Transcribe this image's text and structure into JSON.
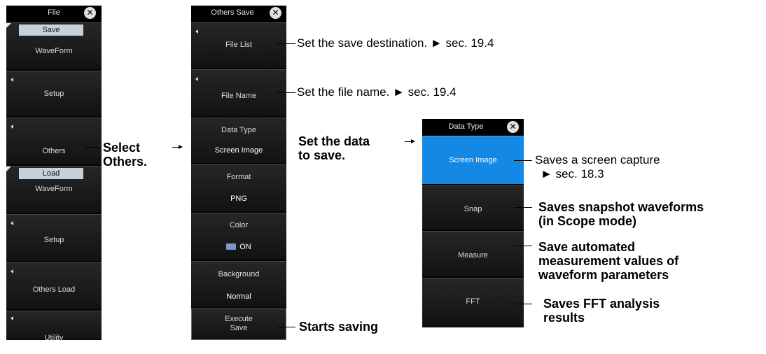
{
  "file_menu": {
    "title": "File",
    "save_tab": "Save",
    "items": [
      {
        "label": "WaveForm"
      },
      {
        "label": "Setup"
      },
      {
        "label": "Others"
      }
    ],
    "load_tab": "Load",
    "load_items": [
      {
        "label": "WaveForm"
      },
      {
        "label": "Setup"
      },
      {
        "label": "Others Load"
      },
      {
        "label": "Utility"
      }
    ]
  },
  "others_save_menu": {
    "title": "Others Save",
    "file_list": "File List",
    "file_name": "File Name",
    "data_type_label": "Data Type",
    "data_type_value": "Screen Image",
    "format_label": "Format",
    "format_value": "PNG",
    "color_label": "Color",
    "color_value": "ON",
    "background_label": "Background",
    "background_value": "Normal",
    "execute_line1": "Execute",
    "execute_line2": "Save"
  },
  "data_type_menu": {
    "title": "Data Type",
    "options": [
      "Screen Image",
      "Snap",
      "Measure",
      "FFT"
    ],
    "selected": "Screen Image"
  },
  "callouts": {
    "select_others_1": "Select",
    "select_others_2": "Others.",
    "file_list_desc": "Set the save destination. ► sec. 19.4",
    "file_name_desc": "Set the file name. ► sec. 19.4",
    "data_type_1": "Set the data",
    "data_type_2": "to save.",
    "screen_image_1": "Saves a screen capture",
    "screen_image_2": "► sec. 18.3",
    "snap_1": "Saves snapshot waveforms",
    "snap_2": "(in Scope mode)",
    "measure_1": "Save automated",
    "measure_2": "measurement values of",
    "measure_3": "waveform parameters",
    "fft_1": "Saves FFT analysis",
    "fft_2": "results",
    "execute": "Starts saving"
  },
  "colors": {
    "panel_bg": "#000000",
    "selected": "#1388e4",
    "tab": "#c5d2dc"
  }
}
